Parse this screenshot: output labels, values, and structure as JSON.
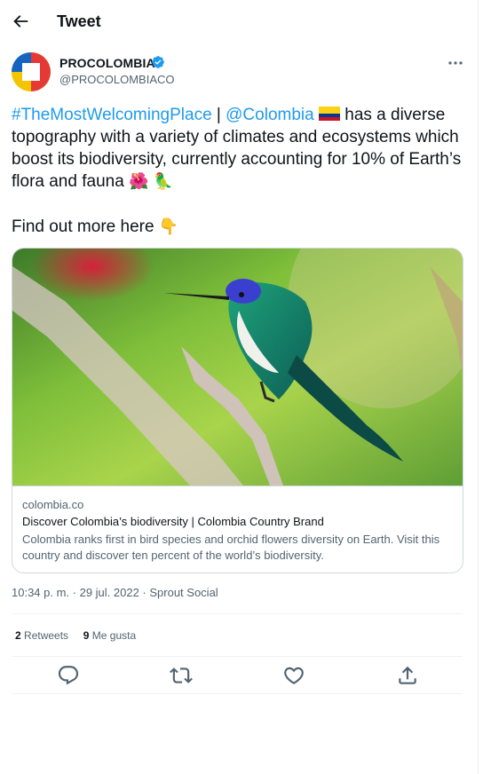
{
  "header": {
    "title": "Tweet"
  },
  "author": {
    "name": "PROCOLOMBIA",
    "handle": "@PROCOLOMBIACO"
  },
  "tweet": {
    "hashtag": "#TheMostWelcomingPlace",
    "separator": " | ",
    "mention": "@Colombia",
    "body": " has a diverse topography with a variety of climates and ecosystems which boost its biodiversity, currently accounting for 10% of Earth’s flora and fauna ",
    "emoji_flower": "🌺",
    "emoji_parrot": "🦜",
    "findout": "Find out more here ",
    "emoji_point": "👇"
  },
  "card": {
    "domain": "colombia.co",
    "title": "Discover Colombia’s biodiversity | Colombia Country Brand",
    "description": "Colombia ranks first in bird species and orchid flowers diversity on Earth. Visit this country and discover ten percent of the world’s biodiversity."
  },
  "meta": {
    "timestamp": "10:34 p. m. · 29 jul. 2022 · Sprout Social"
  },
  "stats": {
    "retweets_count": "2",
    "retweets_label": "Retweets",
    "likes_count": "9",
    "likes_label": "Me gusta"
  },
  "icons": [
    "back-arrow-icon",
    "verified-badge-icon",
    "more-options-icon",
    "reply-icon",
    "retweet-icon",
    "like-icon",
    "share-icon",
    "colombia-flag-icon"
  ],
  "colors": {
    "link": "#1d9bf0",
    "secondary_text": "#536471",
    "border": "#cfd9de"
  }
}
